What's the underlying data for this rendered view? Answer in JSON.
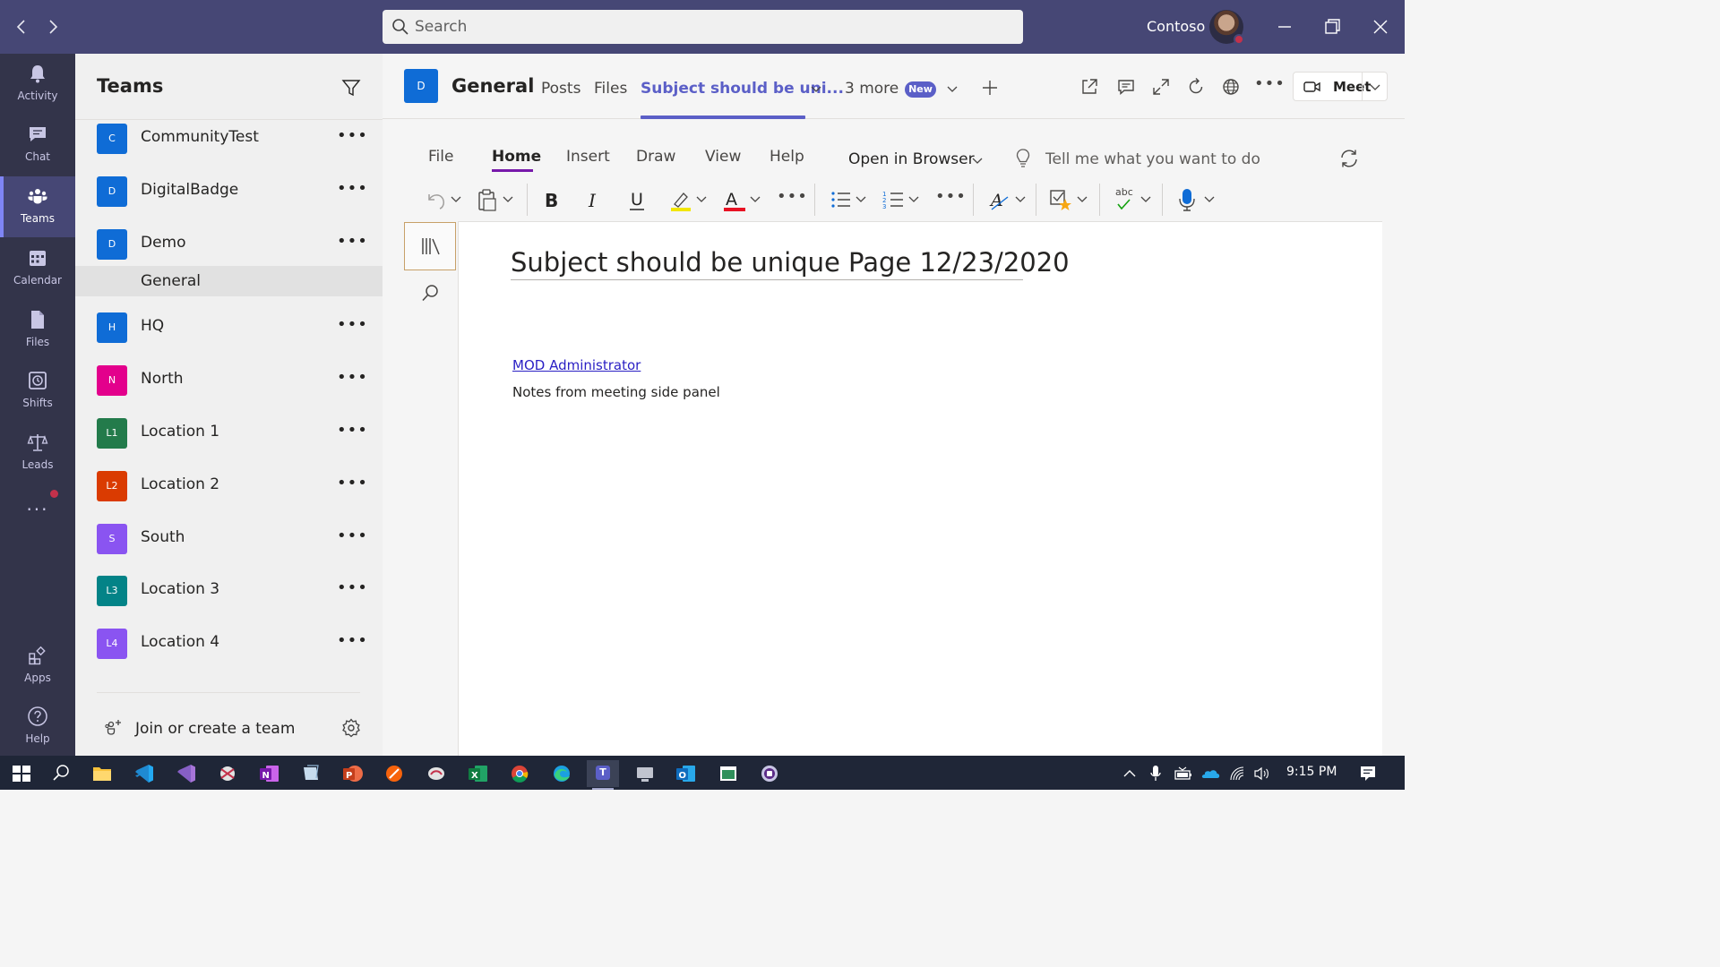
{
  "titlebar": {
    "search_placeholder": "Search",
    "org_name": "Contoso"
  },
  "rail": {
    "items": [
      {
        "label": "Activity",
        "icon": "bell-icon"
      },
      {
        "label": "Chat",
        "icon": "chat-icon"
      },
      {
        "label": "Teams",
        "icon": "teams-icon",
        "active": true
      },
      {
        "label": "Calendar",
        "icon": "calendar-icon"
      },
      {
        "label": "Files",
        "icon": "file-icon"
      },
      {
        "label": "Shifts",
        "icon": "shifts-icon"
      },
      {
        "label": "Leads",
        "icon": "scales-icon"
      }
    ],
    "more": "...",
    "apps_label": "Apps",
    "help_label": "Help"
  },
  "teams_panel": {
    "title": "Teams",
    "teams": [
      {
        "name": "CommunityTest",
        "initial": "C",
        "color": "#0f6cd6"
      },
      {
        "name": "DigitalBadge",
        "initial": "D",
        "color": "#0f6cd6"
      },
      {
        "name": "Demo",
        "initial": "D",
        "color": "#0f6cd6"
      },
      {
        "name": "HQ",
        "initial": "H",
        "color": "#0f6cd6"
      },
      {
        "name": "North",
        "initial": "N",
        "color": "#e3008c"
      },
      {
        "name": "Location 1",
        "initial": "L1",
        "color": "#237b4b"
      },
      {
        "name": "Location 2",
        "initial": "L2",
        "color": "#da3b01"
      },
      {
        "name": "South",
        "initial": "S",
        "color": "#8a54f1"
      },
      {
        "name": "Location 3",
        "initial": "L3",
        "color": "#038387"
      },
      {
        "name": "Location 4",
        "initial": "L4",
        "color": "#8a54f1"
      }
    ],
    "selected_channel": "General",
    "more": "•••",
    "join_label": "Join or create a team"
  },
  "channel_header": {
    "tile_initial": "D",
    "title": "General",
    "tabs": {
      "posts": "Posts",
      "files": "Files",
      "subject": "Subject should be uni...",
      "more": "3 more",
      "new_badge": "New"
    },
    "meet_label": "Meet"
  },
  "ribbon": {
    "tabs": [
      "File",
      "Home",
      "Insert",
      "Draw",
      "View",
      "Help"
    ],
    "open_in_browser": "Open in Browser",
    "tell_me": "Tell me what you want to do",
    "spelling_label": "abc"
  },
  "page": {
    "title": "Subject should be unique Page 12/23/2020",
    "author_link": "MOD Administrator",
    "note": "Notes from meeting side panel"
  },
  "taskbar": {
    "clock": "9:15 PM",
    "teams_tile": "T"
  },
  "colors": {
    "titlebar": "#464775",
    "rail": "#33344a",
    "accent": "#5b5fc7",
    "onenote": "#7719aa",
    "link": "#2a1fc4"
  }
}
